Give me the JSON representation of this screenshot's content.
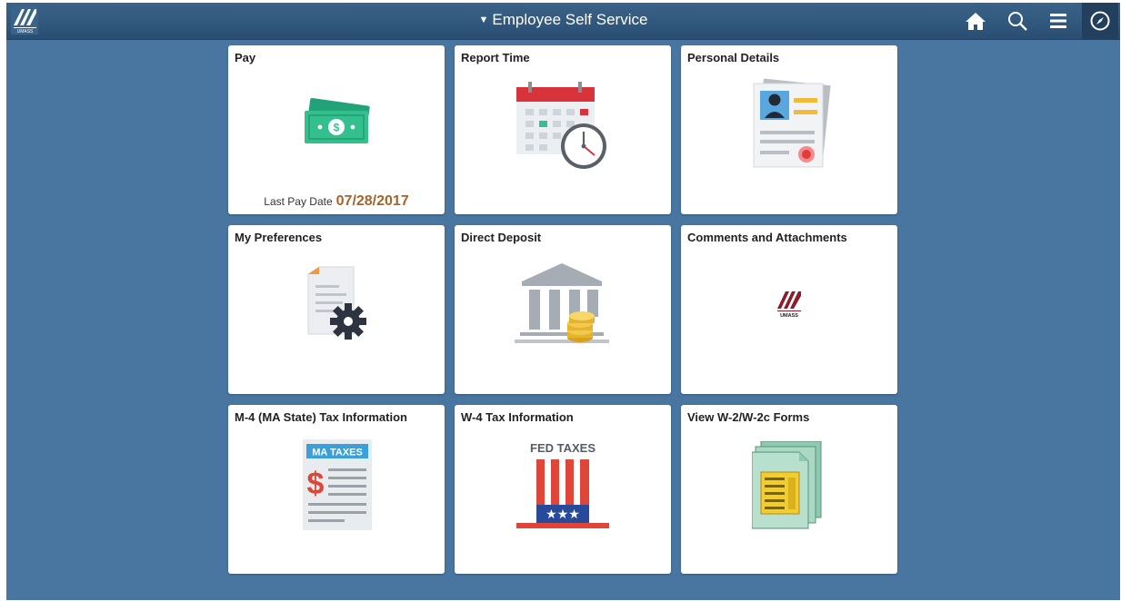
{
  "header": {
    "title": "Employee Self Service",
    "logo_text": "UMASS"
  },
  "tiles": [
    {
      "title": "Pay",
      "icon": "money-icon",
      "subtext_label": "Last Pay Date",
      "subtext_value": "07/28/2017"
    },
    {
      "title": "Report Time",
      "icon": "calendar-clock-icon"
    },
    {
      "title": "Personal Details",
      "icon": "id-card-icon"
    },
    {
      "title": "My Preferences",
      "icon": "document-gear-icon"
    },
    {
      "title": "Direct Deposit",
      "icon": "bank-coins-icon"
    },
    {
      "title": "Comments and Attachments",
      "icon": "umass-logo-icon"
    },
    {
      "title": "M-4 (MA State) Tax Information",
      "icon": "ma-taxes-icon",
      "badge": "MA TAXES"
    },
    {
      "title": "W-4 Tax Information",
      "icon": "fed-taxes-hat-icon",
      "badge": "FED TAXES"
    },
    {
      "title": "View W-2/W-2c Forms",
      "icon": "forms-stack-icon"
    }
  ],
  "colors": {
    "background": "#4876a0",
    "header": "#2f5579",
    "pay_date": "#a8632a"
  }
}
